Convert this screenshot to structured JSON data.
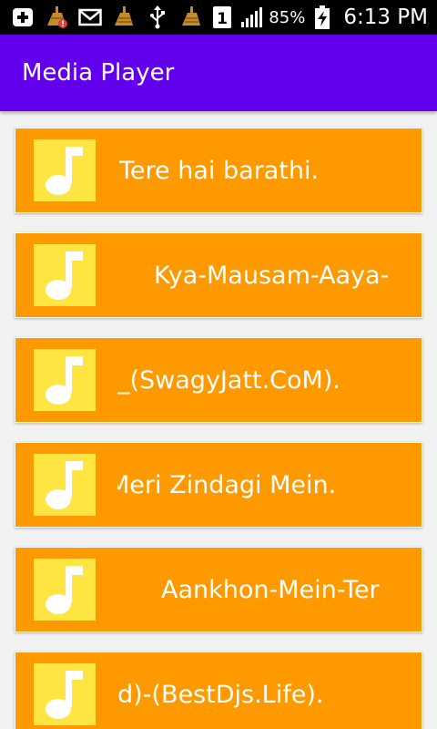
{
  "status_bar": {
    "battery_percent": "85%",
    "time": "6:13 PM",
    "sim_slot": "1",
    "icons": [
      "add-box-icon",
      "cleaner-alert-icon",
      "mail-icon",
      "cleaner-icon",
      "usb-icon",
      "cleaner-icon",
      "sim-1-icon",
      "signal-icon",
      "battery-charging-icon"
    ]
  },
  "app_bar": {
    "title": "Media Player",
    "color": "#6200ee"
  },
  "song_list": {
    "card_color": "#ff9900",
    "thumb_color": "#ffe541",
    "items": [
      {
        "title": "Tere hai barathi.",
        "icon": "music-note-icon"
      },
      {
        "title": "Kya-Mausam-Aaya-",
        "icon": "music-note-icon"
      },
      {
        "title": "_(SwagyJatt.CoM).",
        "icon": "music-note-icon"
      },
      {
        "title": "Meri Zindagi Mein.",
        "icon": "music-note-icon"
      },
      {
        "title": "Aankhon-Mein-Ter",
        "icon": "music-note-icon"
      },
      {
        "title": "d)-(BestDjs.Life).",
        "icon": "music-note-icon"
      }
    ]
  }
}
